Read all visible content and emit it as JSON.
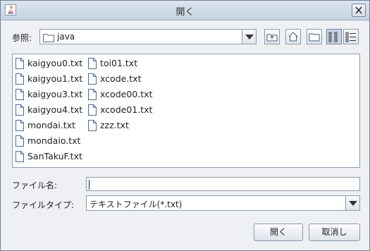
{
  "window": {
    "title": "開く"
  },
  "lookin": {
    "label": "参照:",
    "value": "java"
  },
  "files": [
    {
      "name": "kaigyou0.txt"
    },
    {
      "name": "kaigyou1.txt"
    },
    {
      "name": "kaigyou3.txt"
    },
    {
      "name": "kaigyou4.txt"
    },
    {
      "name": "mondai.txt"
    },
    {
      "name": "mondaio.txt"
    },
    {
      "name": "SanTakuF.txt"
    },
    {
      "name": "toi01.txt"
    },
    {
      "name": "xcode.txt"
    },
    {
      "name": "xcode00.txt"
    },
    {
      "name": "xcode01.txt"
    },
    {
      "name": "zzz.txt"
    }
  ],
  "filename": {
    "label": "ファイル名:",
    "value": ""
  },
  "filetype": {
    "label": "ファイルタイプ:",
    "value": "テキストファイル(*.txt)"
  },
  "buttons": {
    "open": "開く",
    "cancel": "取消し"
  }
}
